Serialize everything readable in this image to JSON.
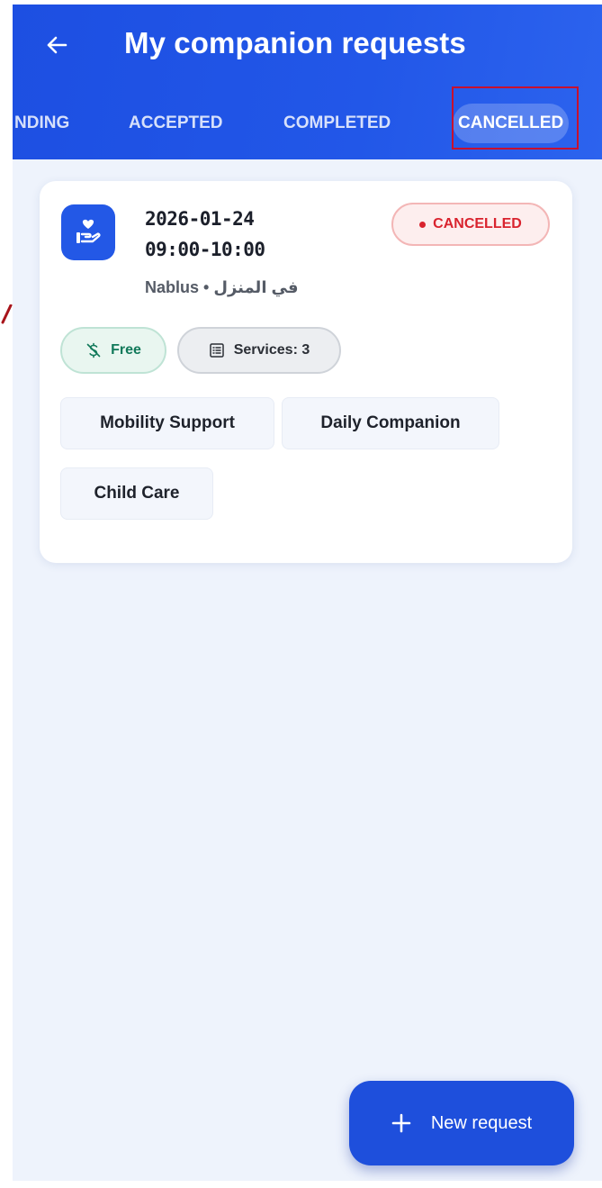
{
  "header": {
    "title": "My companion requests",
    "back_icon": "arrow-left-icon"
  },
  "tabs": [
    {
      "label": "NDING",
      "active": false
    },
    {
      "label": "ACCEPTED",
      "active": false
    },
    {
      "label": "COMPLETED",
      "active": false
    },
    {
      "label": "CANCELLED",
      "active": true
    }
  ],
  "request": {
    "date": "2026-01-24",
    "time": "09:00-10:00",
    "location": "Nablus • في المنزل",
    "status": "CANCELLED",
    "price": "Free",
    "services_count": "Services: 3",
    "services": [
      "Mobility Support",
      "Daily Companion",
      "Child Care"
    ],
    "icon": "hand-heart-icon"
  },
  "fab": {
    "label": "New request",
    "icon": "plus-icon"
  },
  "colors": {
    "primary": "#2257e8",
    "status_cancelled": "#d9232e",
    "free_green": "#11795a",
    "background": "#eef3fc"
  }
}
